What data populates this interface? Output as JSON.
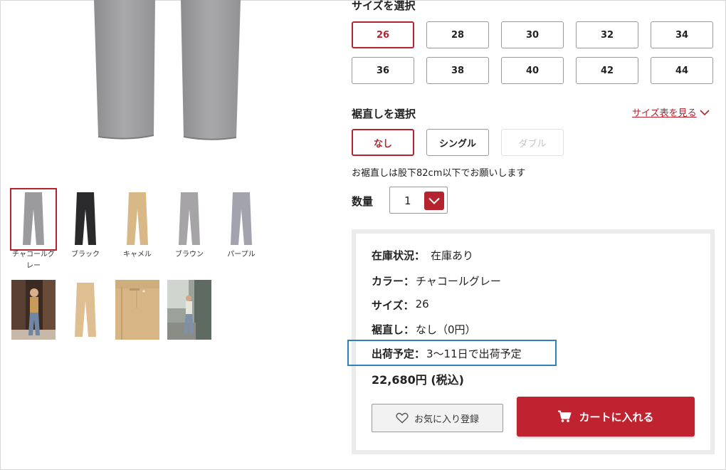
{
  "size": {
    "title": "サイズを選択",
    "options": [
      "26",
      "28",
      "30",
      "32",
      "34",
      "36",
      "38",
      "40",
      "42",
      "44"
    ],
    "selected": "26"
  },
  "hem": {
    "title": "裾直しを選択",
    "size_chart_link": "サイズ表を見る",
    "options": [
      {
        "label": "なし",
        "state": "selected"
      },
      {
        "label": "シングル",
        "state": "enabled"
      },
      {
        "label": "ダブル",
        "state": "disabled"
      }
    ],
    "note": "お裾直しは股下82cm以下でお願いします"
  },
  "quantity": {
    "label": "数量",
    "value": "1"
  },
  "colors": [
    {
      "name": "チャコールグレー",
      "label_lines": [
        "チャコールグ",
        "レー"
      ],
      "swatch": "#9b9b9d",
      "selected": true
    },
    {
      "name": "ブラック",
      "label_lines": [
        "ブラック"
      ],
      "swatch": "#2a2a2c",
      "selected": false
    },
    {
      "name": "キャメル",
      "label_lines": [
        "キャメル"
      ],
      "swatch": "#d9b888",
      "selected": false
    },
    {
      "name": "ブラウン",
      "label_lines": [
        "ブラウン"
      ],
      "swatch": "#a7a4a8",
      "selected": false
    },
    {
      "name": "パープル",
      "label_lines": [
        "パープル"
      ],
      "swatch": "#a3a3ad",
      "selected": false
    }
  ],
  "summary": {
    "stock": {
      "label": "在庫状況：",
      "value": "在庫あり"
    },
    "color": {
      "label": "カラー：",
      "value": "チャコールグレー"
    },
    "size": {
      "label": "サイズ：",
      "value": "26"
    },
    "hem": {
      "label": "裾直し：",
      "value": "なし（0円）"
    },
    "shipping": {
      "label": "出荷予定：",
      "value": "3〜11日で出荷予定"
    },
    "price": "22,680円 (税込)"
  },
  "buttons": {
    "favorite": "お気に入り登録",
    "cart": "カートに入れる"
  },
  "theme": {
    "accent": "#b4232e",
    "cart_button": "#bf2330",
    "highlight": "#2d82bd"
  }
}
